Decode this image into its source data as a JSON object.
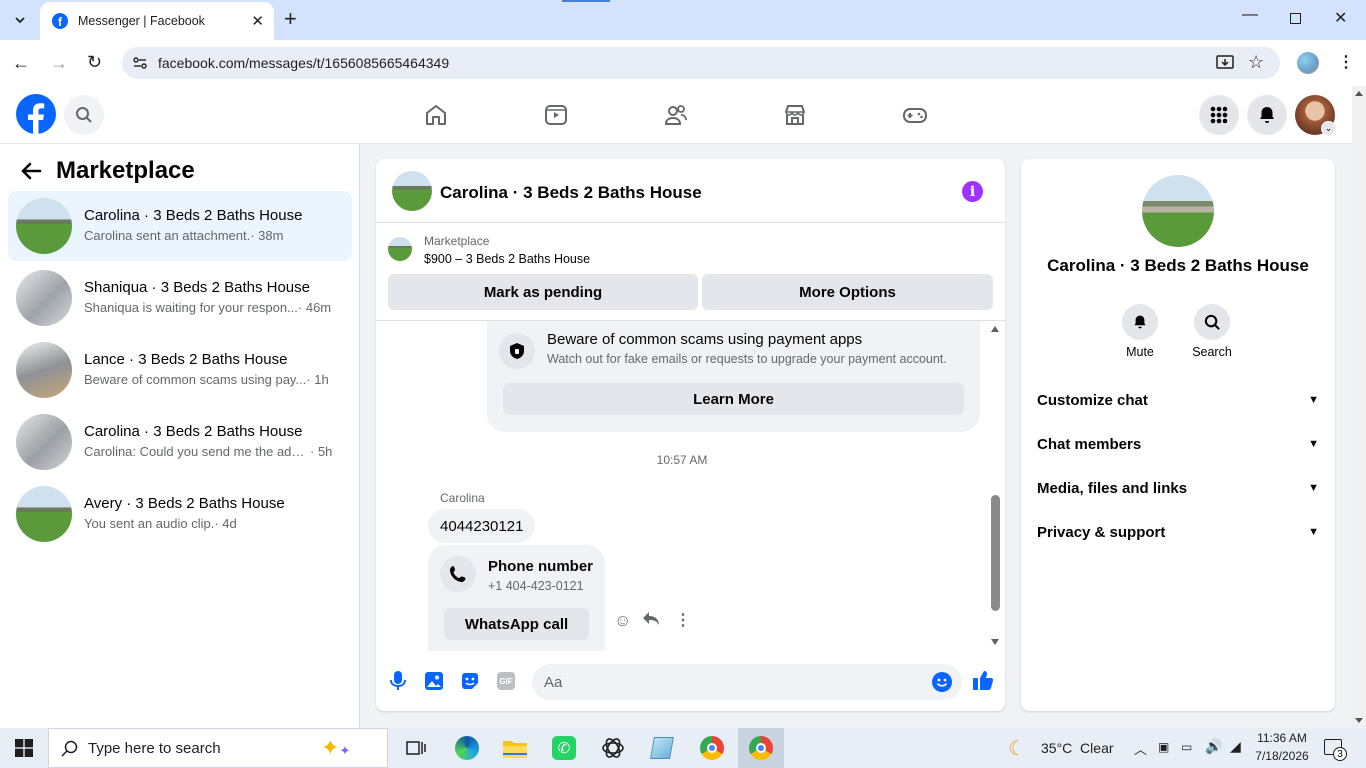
{
  "browser": {
    "tab_title": "Messenger | Facebook",
    "url": "facebook.com/messages/t/1656085665464349"
  },
  "fb": {
    "logo": "facebook-logo"
  },
  "left": {
    "title": "Marketplace",
    "conversations": [
      {
        "name": "Carolina · 3 Beds 2 Baths House",
        "snippet": "Carolina sent an attachment.",
        "time": " · 38m"
      },
      {
        "name": "Shaniqua · 3 Beds 2 Baths House",
        "snippet": "Shaniqua is waiting for your respon...",
        "time": " · 46m"
      },
      {
        "name": "Lance · 3 Beds 2 Baths House",
        "snippet": "Beware of common scams using pay...",
        "time": " · 1h"
      },
      {
        "name": "Carolina · 3 Beds 2 Baths House",
        "snippet": "Carolina: Could you send me the addr...",
        "time": " · 5h"
      },
      {
        "name": "Avery · 3 Beds 2 Baths House",
        "snippet": "You sent an audio clip.",
        "time": " · 4d"
      }
    ]
  },
  "chat": {
    "title": "Carolina · 3 Beds 2 Baths House",
    "listing_source": "Marketplace",
    "listing": "$900 – 3 Beds 2 Baths House",
    "mark_pending": "Mark as pending",
    "more_options": "More Options",
    "scam_title": "Beware of common scams using payment apps",
    "scam_body": "Watch out for fake emails or requests to upgrade your payment account.",
    "learn_more": "Learn More",
    "timestamp": "10:57 AM",
    "sender": "Carolina",
    "message": "4044230121",
    "phone_title": "Phone number",
    "phone_number": "+1 404-423-0121",
    "whatsapp": "WhatsApp call",
    "composer_placeholder": "Aa"
  },
  "info": {
    "name": "Carolina · 3 Beds 2 Baths House",
    "mute": "Mute",
    "search": "Search",
    "sections": [
      "Customize chat",
      "Chat members",
      "Media, files and links",
      "Privacy & support"
    ]
  },
  "taskbar": {
    "search_placeholder": "Type here to search",
    "weather": "35°C  Clear",
    "time": "11:36 AM",
    "date": "7/18/2026",
    "notifications": "3"
  },
  "colors": {
    "fb_blue": "#0866ff",
    "messenger_purple": "#a033ff",
    "selected_bg": "#ebf5ff"
  }
}
